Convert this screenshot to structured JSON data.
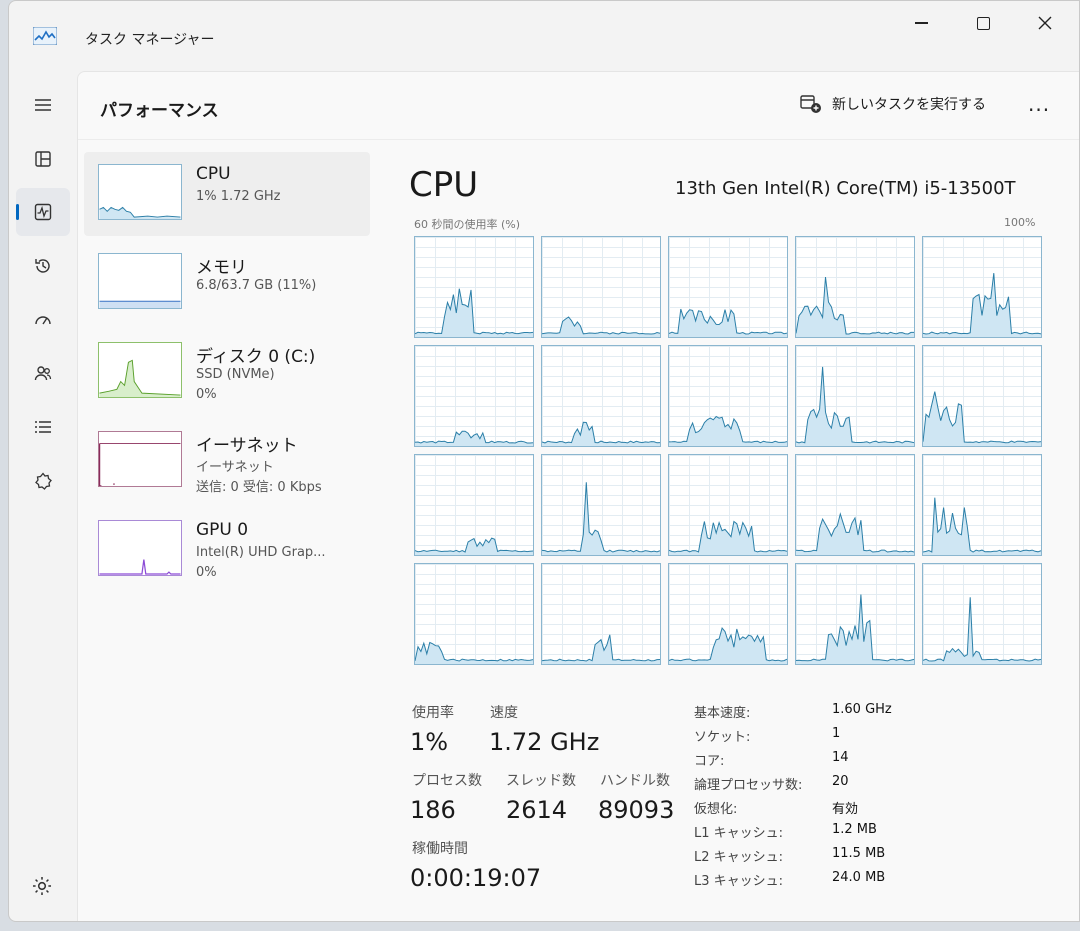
{
  "window": {
    "title": "タスク マネージャー"
  },
  "header": {
    "page_title": "パフォーマンス",
    "run_task": "新しいタスクを実行する",
    "more": "..."
  },
  "nav": [
    {
      "name": "menu",
      "icon": "hamburger-icon"
    },
    {
      "name": "processes",
      "icon": "processes-icon"
    },
    {
      "name": "performance",
      "icon": "performance-icon",
      "active": true
    },
    {
      "name": "app-history",
      "icon": "history-icon"
    },
    {
      "name": "startup",
      "icon": "startup-icon"
    },
    {
      "name": "users",
      "icon": "users-icon"
    },
    {
      "name": "details",
      "icon": "details-icon"
    },
    {
      "name": "services",
      "icon": "services-icon"
    },
    {
      "name": "settings",
      "icon": "gear-icon"
    }
  ],
  "resources": [
    {
      "name": "CPU",
      "line1": "1%  1.72 GHz",
      "line2": ""
    },
    {
      "name": "メモリ",
      "line1": "6.8/63.7 GB (11%)",
      "line2": ""
    },
    {
      "name": "ディスク 0 (C:)",
      "line1": "SSD (NVMe)",
      "line2": "0%"
    },
    {
      "name": "イーサネット",
      "line1": "イーサネット",
      "line2": "送信: 0 受信: 0 Kbps"
    },
    {
      "name": "GPU 0",
      "line1": "Intel(R) UHD Grap...",
      "line2": "0%"
    }
  ],
  "cpu": {
    "title": "CPU",
    "model": "13th Gen Intel(R) Core(TM) i5-13500T",
    "graph_caption": "60 秒間の使用率 (%)",
    "graph_max": "100%",
    "core_count_shown": 20
  },
  "stats": {
    "usage_label": "使用率",
    "usage": "1%",
    "speed_label": "速度",
    "speed": "1.72 GHz",
    "processes_label": "プロセス数",
    "processes": "186",
    "threads_label": "スレッド数",
    "threads": "2614",
    "handles_label": "ハンドル数",
    "handles": "89093",
    "uptime_label": "稼働時間",
    "uptime": "0:00:19:07"
  },
  "specs": [
    {
      "label": "基本速度:",
      "value": "1.60 GHz"
    },
    {
      "label": "ソケット:",
      "value": "1"
    },
    {
      "label": "コア:",
      "value": "14"
    },
    {
      "label": "論理プロセッサ数:",
      "value": "20"
    },
    {
      "label": "仮想化:",
      "value": "有効"
    },
    {
      "label": "L1 キャッシュ:",
      "value": "1.2 MB"
    },
    {
      "label": "L2 キャッシュ:",
      "value": "11.5 MB"
    },
    {
      "label": "L3 キャッシュ:",
      "value": "24.0 MB"
    }
  ],
  "colors": {
    "cpu_line": "#2b7fa8",
    "cpu_fill": "#cfe6f3",
    "disk": "#5aa02c",
    "ethernet": "#8a2b5a",
    "gpu": "#8c4bd6",
    "accent": "#0067c0"
  }
}
